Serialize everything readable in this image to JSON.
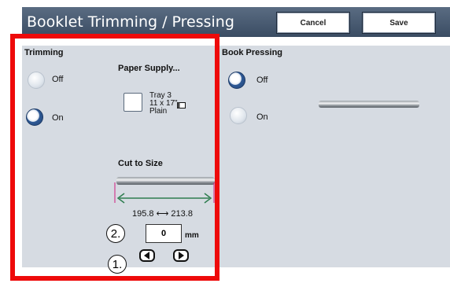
{
  "header": {
    "title": "Booklet Trimming / Pressing",
    "cancel_label": "Cancel",
    "save_label": "Save"
  },
  "trimming": {
    "title": "Trimming",
    "options": [
      {
        "label": "Off",
        "selected": false
      },
      {
        "label": "On",
        "selected": true
      }
    ]
  },
  "paper_supply": {
    "title": "Paper Supply...",
    "tray": "Tray 3",
    "size": "11 x 17\"",
    "type": "Plain"
  },
  "cut_to_size": {
    "title": "Cut to Size",
    "range": "195.8 ⟷ 213.8",
    "value": "0",
    "unit": "mm",
    "step_1": "1.",
    "step_2": "2."
  },
  "book_pressing": {
    "title": "Book Pressing",
    "options": [
      {
        "label": "Off",
        "selected": true
      },
      {
        "label": "On",
        "selected": false
      }
    ]
  },
  "colors": {
    "header_bg": "#46586f",
    "panel_bg": "#d6dbe2",
    "highlight_frame": "#ee0a0a",
    "arrow_green": "#2e7d4f",
    "radio_selected": "#24467a"
  },
  "icons": {
    "paper_orientation": "landscape-sheet-icon",
    "decrement": "left-arrow-icon",
    "increment": "right-arrow-icon"
  }
}
